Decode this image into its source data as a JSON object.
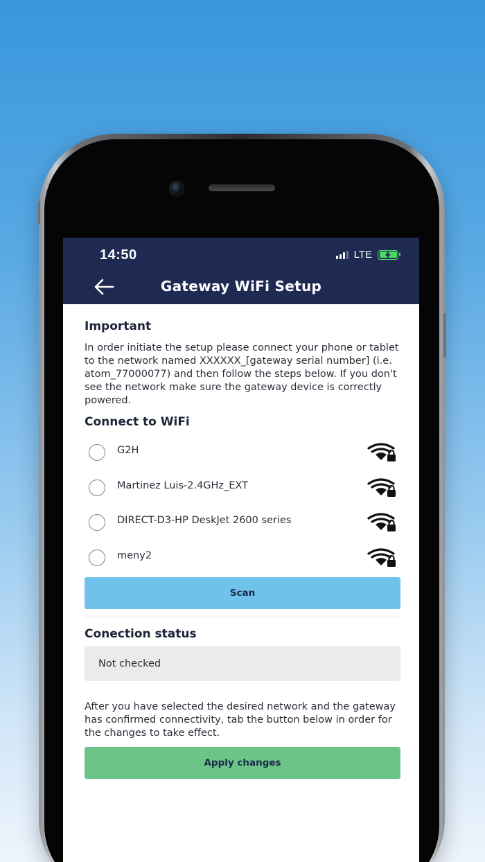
{
  "status_bar": {
    "time": "14:50",
    "network": "LTE",
    "signal_bars": 3,
    "battery_level": 1.0,
    "battery_charging": true
  },
  "header": {
    "title": "Gateway WiFi Setup",
    "back_icon": "arrow-left-icon"
  },
  "important": {
    "title": "Important",
    "body": "In order initiate the setup please connect your phone or tablet to the network named XXXXXX_[gateway serial number] (i.e. atom_77000077) and then follow the steps below. If you don't see the network make sure the gateway device is correctly powered."
  },
  "wifi": {
    "title": "Connect to WiFi",
    "networks": [
      {
        "name": "G2H",
        "icon": "wifi-lock-icon"
      },
      {
        "name": "Martinez Luis-2.4GHz_EXT",
        "icon": "wifi-lock-icon"
      },
      {
        "name": "DIRECT-D3-HP DeskJet 2600 series",
        "icon": "wifi-lock-icon"
      },
      {
        "name": "meny2",
        "icon": "wifi-lock-icon"
      }
    ],
    "scan_label": "Scan"
  },
  "connection": {
    "title": "Conection status",
    "status": "Not checked"
  },
  "apply": {
    "text": "After you have selected the desired network and the gateway has confirmed connectivity, tab the button below in order for the changes to take effect.",
    "button_label": "Apply changes"
  },
  "colors": {
    "header_bg": "#1e2a52",
    "scan_button": "#70c2ea",
    "apply_button": "#6cc488",
    "status_box": "#ebebeb",
    "battery": "#4cd964"
  }
}
